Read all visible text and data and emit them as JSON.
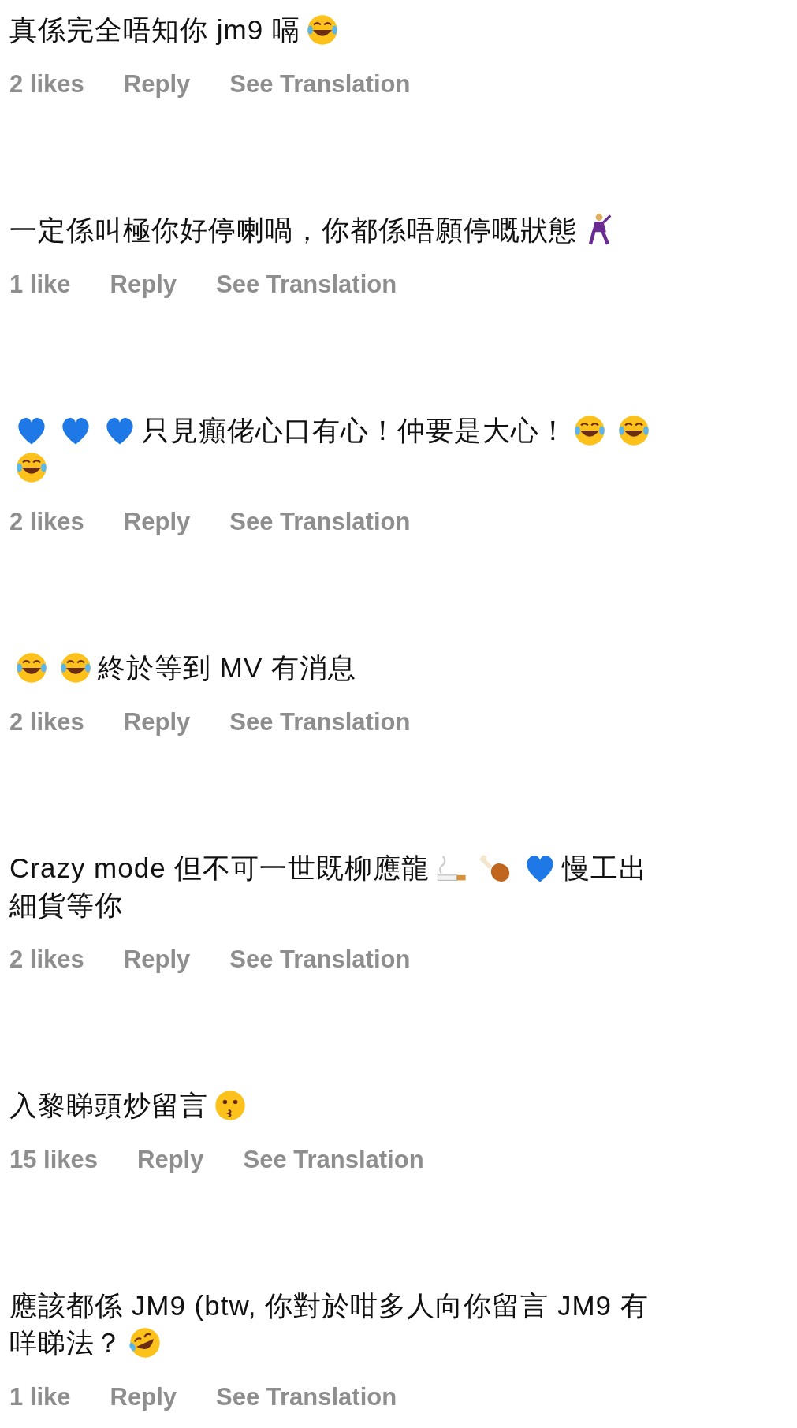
{
  "comments": [
    {
      "lines": [
        [
          {
            "kind": "text",
            "text": "真係完全唔知你 jm9 嗝"
          },
          {
            "kind": "tears-of-joy"
          }
        ]
      ],
      "likes": "2 likes",
      "reply": "Reply",
      "translate": "See Translation"
    },
    {
      "lines": [
        [
          {
            "kind": "text",
            "text": "一定係叫極你好停喇喎，你都係唔願停嘅狀態"
          },
          {
            "kind": "dancer"
          }
        ]
      ],
      "likes": "1 like",
      "reply": "Reply",
      "translate": "See Translation"
    },
    {
      "lines": [
        [
          {
            "kind": "blue-heart"
          },
          {
            "kind": "blue-heart"
          },
          {
            "kind": "blue-heart"
          },
          {
            "kind": "text",
            "text": "只見癲佬心口有心！仲要是大心！"
          },
          {
            "kind": "tears-of-joy"
          },
          {
            "kind": "tears-of-joy"
          }
        ],
        [
          {
            "kind": "tears-of-joy"
          }
        ]
      ],
      "likes": "2 likes",
      "reply": "Reply",
      "translate": "See Translation"
    },
    {
      "lines": [
        [
          {
            "kind": "tears-of-joy"
          },
          {
            "kind": "tears-of-joy"
          },
          {
            "kind": "text",
            "text": "終於等到 MV 有消息"
          }
        ]
      ],
      "likes": "2 likes",
      "reply": "Reply",
      "translate": "See Translation"
    },
    {
      "lines": [
        [
          {
            "kind": "text",
            "text": "Crazy mode 但不可一世既柳應龍"
          },
          {
            "kind": "cigarette"
          },
          {
            "kind": "drumstick"
          },
          {
            "kind": "blue-heart"
          },
          {
            "kind": "text",
            "text": "慢工出"
          }
        ],
        [
          {
            "kind": "text",
            "text": "細貨等你"
          }
        ]
      ],
      "likes": "2 likes",
      "reply": "Reply",
      "translate": "See Translation"
    },
    {
      "lines": [
        [
          {
            "kind": "text",
            "text": "入黎睇頭炒留言"
          },
          {
            "kind": "kissing"
          }
        ]
      ],
      "likes": "15 likes",
      "reply": "Reply",
      "translate": "See Translation"
    },
    {
      "lines": [
        [
          {
            "kind": "text",
            "text": "應該都係 JM9 (btw, 你對於咁多人向你留言 JM9 有"
          }
        ],
        [
          {
            "kind": "text",
            "text": "咩睇法？"
          },
          {
            "kind": "rolling-laughing"
          }
        ]
      ],
      "likes": "1 like",
      "reply": "Reply",
      "translate": "See Translation"
    }
  ]
}
